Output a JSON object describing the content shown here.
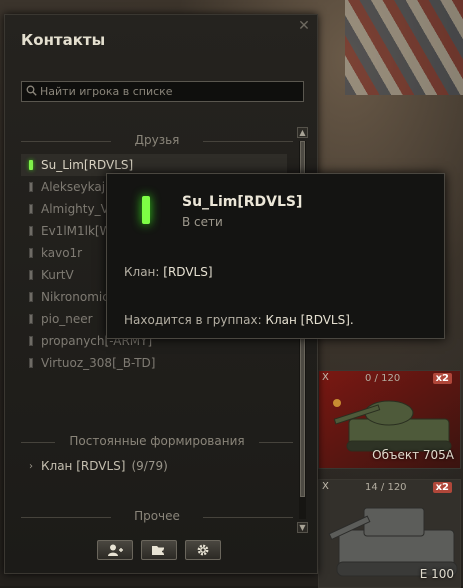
{
  "window": {
    "title": "Контакты",
    "search_placeholder": "Найти игрока в списке"
  },
  "sections": {
    "friends": "Друзья",
    "permanent": "Постоянные формирования",
    "other": "Прочее"
  },
  "friends": [
    {
      "name": "Su_Lim[RDVLS]",
      "online": true,
      "selected": true
    },
    {
      "name": "Alekseykaj",
      "online": false
    },
    {
      "name": "Almighty_V",
      "online": false
    },
    {
      "name": "Ev1lM1lk[W",
      "online": false
    },
    {
      "name": "kavo1r",
      "online": false
    },
    {
      "name": "KurtV",
      "online": false
    },
    {
      "name": "Nikronomic",
      "online": false
    },
    {
      "name": "pio_neer",
      "online": false
    },
    {
      "name": "propanych[-ARMY]",
      "online": false
    },
    {
      "name": "Virtuoz_308[_B-TD]",
      "online": false
    }
  ],
  "group": {
    "name": "Клан [RDVLS]",
    "count": "(9/79)"
  },
  "tooltip": {
    "name": "Su_Lim[RDVLS]",
    "status": "В сети",
    "clan_label": "Клан:",
    "clan_value": "[RDVLS]",
    "groups_label": "Находится в группах:",
    "groups_value": "Клан [RDVLS]."
  },
  "vehicles": [
    {
      "name": "Объект 705А",
      "xp": "0 / 120",
      "multiplier": "x2",
      "mark": "X"
    },
    {
      "name": "E 100",
      "xp": "14 / 120",
      "multiplier": "x2",
      "mark": "X"
    }
  ],
  "icons": [
    "close-icon",
    "search-icon",
    "add-contact-icon",
    "add-group-icon",
    "settings-gear-icon"
  ]
}
